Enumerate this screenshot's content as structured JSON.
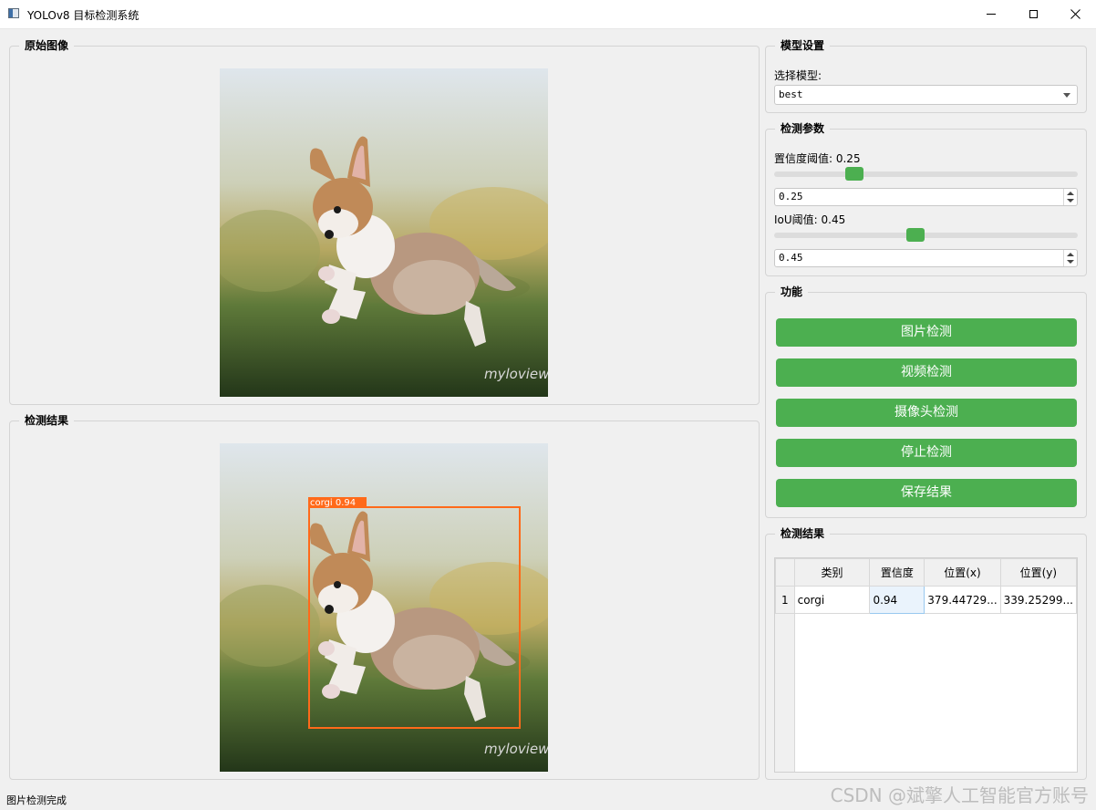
{
  "window": {
    "title": "YOLOv8 目标检测系统"
  },
  "original_panel": {
    "title": "原始图像"
  },
  "result_panel": {
    "title": "检测结果",
    "detection_label": "corgi 0.94",
    "image_watermark": "myloview"
  },
  "model_settings": {
    "title": "模型设置",
    "select_label": "选择模型:",
    "selected_model": "best"
  },
  "detection_params": {
    "title": "检测参数",
    "confidence_label": "置信度阈值: 0.25",
    "confidence_value": "0.25",
    "confidence_level": 0.25,
    "iou_label": "IoU阈值: 0.45",
    "iou_value": "0.45",
    "iou_level": 0.45
  },
  "functions": {
    "title": "功能",
    "image_detect": "图片检测",
    "video_detect": "视频检测",
    "camera_detect": "摄像头检测",
    "stop_detect": "停止检测",
    "save_results": "保存结果"
  },
  "results_table": {
    "title": "检测结果",
    "headers": [
      "类别",
      "置信度",
      "位置(x)",
      "位置(y)"
    ],
    "rows": [
      {
        "index": "1",
        "class": "corgi",
        "confidence": "0.94",
        "x": "379.44729...",
        "y": "339.25299..."
      }
    ]
  },
  "status": {
    "message": "图片检测完成"
  },
  "watermark": "CSDN @斌擎人工智能官方账号",
  "colors": {
    "accent_green": "#4caf50",
    "box_orange": "#ff6a1a"
  }
}
